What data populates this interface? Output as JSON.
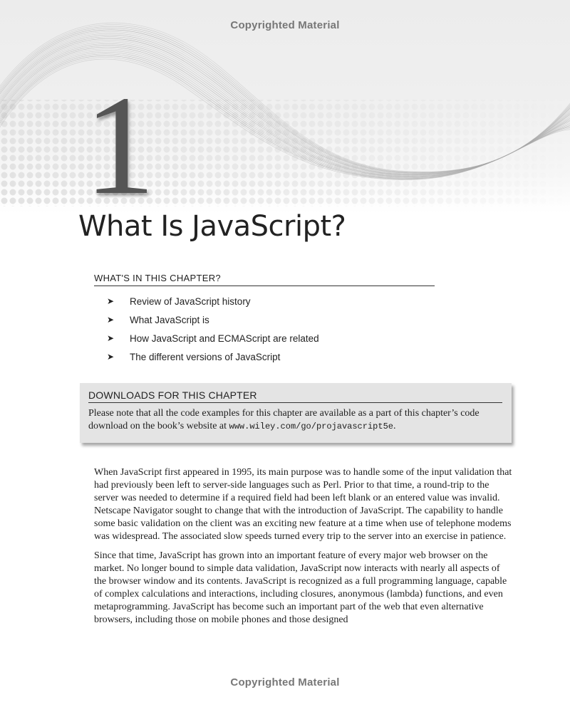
{
  "watermark": {
    "top": "Copyrighted Material",
    "bottom": "Copyrighted Material"
  },
  "chapter": {
    "number": "1",
    "title": "What Is JavaScript?"
  },
  "whats_in": {
    "heading": "WHAT'S IN THIS CHAPTER?",
    "bullet_icon": "arrowhead-icon",
    "items": [
      "Review of JavaScript history",
      "What JavaScript is",
      "How JavaScript and ECMAScript are related",
      "The different versions of JavaScript"
    ]
  },
  "downloads": {
    "heading": "DOWNLOADS FOR THIS CHAPTER",
    "text_before": "Please note that all the code examples for this chapter are available as a part of this chapter’s code download on the book’s website at ",
    "url": "www.wiley.com/go/projavascript5e",
    "text_after": "."
  },
  "paragraphs": [
    "When JavaScript first appeared in 1995, its main purpose was to handle some of the input validation that had previously been left to server-side languages such as Perl. Prior to that time, a round-trip to the server was needed to determine if a required field had been left blank or an entered value was invalid. Netscape Navigator sought to change that with the introduction of JavaScript. The capability to handle some basic validation on the client was an exciting new feature at a time when use of telephone modems was widespread. The associated slow speeds turned every trip to the server into an exercise in patience.",
    "Since that time, JavaScript has grown into an important feature of every major web browser on the market. No longer bound to simple data validation, JavaScript now interacts with nearly all aspects of the browser window and its contents. JavaScript is recognized as a full programming language, capable of complex calculations and interactions, including closures, anonymous (lambda) functions, and even metaprogramming. JavaScript has become such an important part of the web that even alternative browsers, including those on mobile phones and those designed"
  ]
}
